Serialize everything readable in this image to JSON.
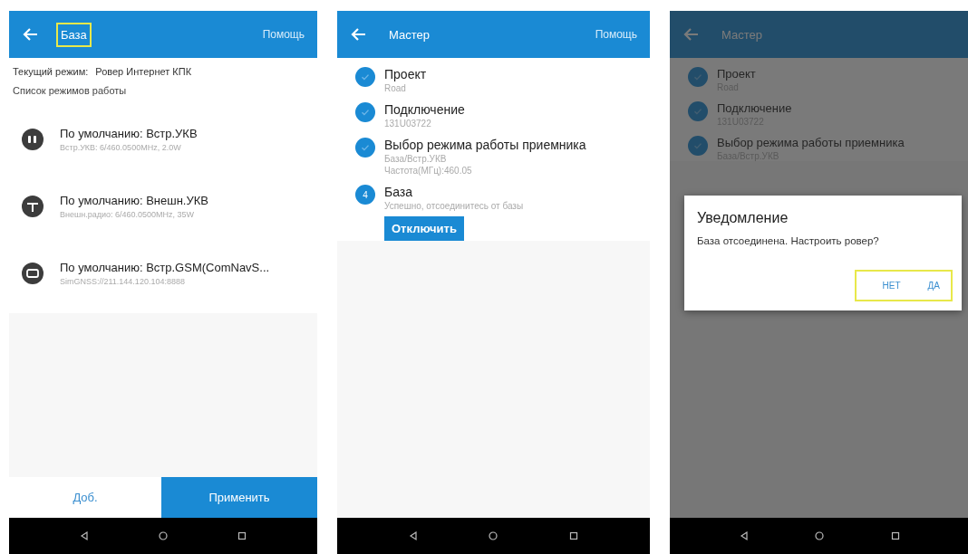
{
  "screens": [
    {
      "kind": "modes",
      "dimmed": false,
      "app_bar": {
        "title": "База",
        "title_highlighted": true,
        "help": "Помощь"
      },
      "current_mode": {
        "label": "Текущий режим:",
        "value": "Ровер Интернет КПК"
      },
      "list_heading": "Список режимов работы",
      "modes": [
        {
          "title": "По умолчанию: Встр.УКВ",
          "detail": "Встр.УКВ: 6/460.0500MHz, 2.0W"
        },
        {
          "title": "По умолчанию: Внешн.УКВ",
          "detail": "Внешн.радио: 6/460.0500MHz, 35W"
        },
        {
          "title": "По умолчанию: Встр.GSM(ComNavS...",
          "detail": "SimGNSS://211.144.120.104:8888"
        }
      ],
      "buttons": {
        "add": "Доб.",
        "apply": "Применить"
      }
    },
    {
      "kind": "wizard",
      "dimmed": false,
      "app_bar": {
        "title": "Мастер",
        "title_highlighted": false,
        "help": "Помощь"
      },
      "steps": [
        {
          "done": true,
          "title": "Проект",
          "details": [
            "Road"
          ]
        },
        {
          "done": true,
          "title": "Подключение",
          "details": [
            "131U03722"
          ]
        },
        {
          "done": true,
          "title": "Выбор режима работы приемника",
          "details": [
            "База/Встр.УКВ",
            "Частота(МГц):460.05"
          ]
        },
        {
          "done": false,
          "number": "4",
          "title": "База",
          "details": [
            "Успешно, отсоединитесь от базы"
          ],
          "button": "Отключить"
        }
      ]
    },
    {
      "kind": "wizard",
      "dimmed": true,
      "app_bar": {
        "title": "Мастер",
        "title_highlighted": false
      },
      "steps": [
        {
          "done": true,
          "title": "Проект",
          "details": [
            "Road"
          ]
        },
        {
          "done": true,
          "title": "Подключение",
          "details": [
            "131U03722"
          ]
        },
        {
          "done": true,
          "title": "Выбор режима работы приемника",
          "details": [
            "База/Встр.УКВ"
          ]
        }
      ],
      "dialog": {
        "title": "Уведомление",
        "message": "База отсоединена. Настроить ровер?",
        "buttons": [
          "НЕТ",
          "ДА"
        ],
        "buttons_highlighted": true
      }
    }
  ]
}
